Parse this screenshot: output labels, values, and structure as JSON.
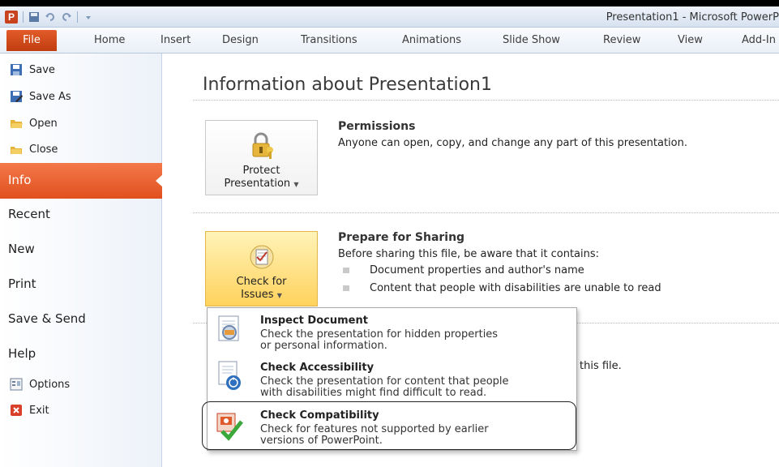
{
  "window": {
    "title": "Presentation1 - Microsoft PowerP"
  },
  "qat": {
    "app_icon": "P",
    "icons": [
      "powerpoint-app-icon",
      "save-icon",
      "undo-icon",
      "redo-icon",
      "customize-qat-icon"
    ]
  },
  "ribbon": {
    "file_tab": "File",
    "tabs": [
      "Home",
      "Insert",
      "Design",
      "Transitions",
      "Animations",
      "Slide Show",
      "Review",
      "View",
      "Add-In"
    ]
  },
  "sidebar": {
    "small_items": [
      {
        "label": "Save",
        "icon": "save-icon"
      },
      {
        "label": "Save As",
        "icon": "save-as-icon"
      },
      {
        "label": "Open",
        "icon": "open-folder-icon"
      },
      {
        "label": "Close",
        "icon": "close-folder-icon"
      }
    ],
    "active": "Info",
    "big_items": [
      "Recent",
      "New",
      "Print",
      "Save & Send",
      "Help"
    ],
    "bottom_items": [
      {
        "label": "Options",
        "icon": "options-icon"
      },
      {
        "label": "Exit",
        "icon": "exit-icon"
      }
    ]
  },
  "main": {
    "title": "Information about Presentation1",
    "permissions": {
      "button_line1": "Protect",
      "button_line2": "Presentation",
      "heading": "Permissions",
      "text": "Anyone can open, copy, and change any part of this presentation."
    },
    "sharing": {
      "button_line1": "Check for",
      "button_line2": "Issues",
      "heading": "Prepare for Sharing",
      "text": "Before sharing this file, be aware that it contains:",
      "bullets": [
        "Document properties and author's name",
        "Content that people with disabilities are unable to read"
      ]
    },
    "partial_text": "this file."
  },
  "dropdown": {
    "items": [
      {
        "title": "Inspect Document",
        "desc1": "Check the presentation for hidden properties",
        "desc2": "or personal information.",
        "icon": "inspect-document-icon"
      },
      {
        "title": "Check Accessibility",
        "desc1": "Check the presentation for content that people",
        "desc2": "with disabilities might find difficult to read.",
        "icon": "accessibility-icon"
      },
      {
        "title": "Check Compatibility",
        "desc1": "Check for features not supported by earlier",
        "desc2": "versions of PowerPoint.",
        "icon": "compatibility-icon"
      }
    ]
  },
  "colors": {
    "file_tab": "#d2491a",
    "active_sidebar": "#ea6530",
    "check_button": "#ffd25c"
  }
}
